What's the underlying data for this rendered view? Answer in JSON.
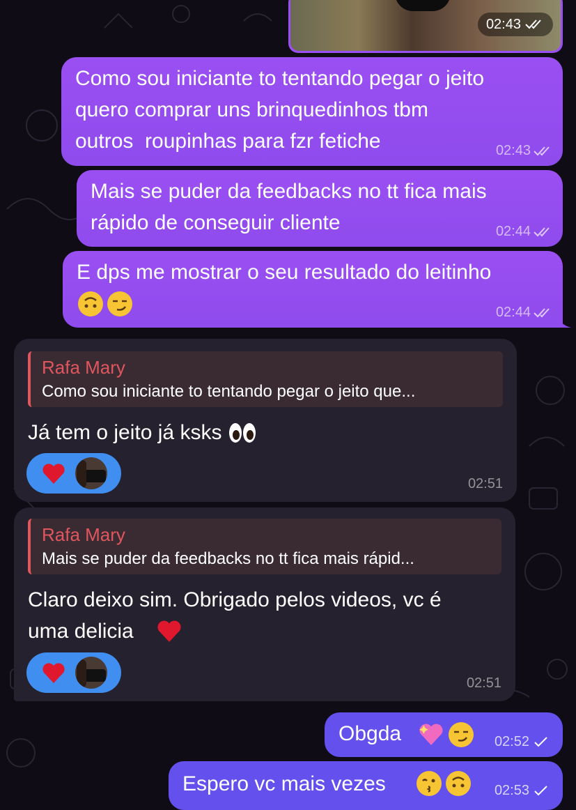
{
  "photo": {
    "time": "02:43"
  },
  "messages": [
    {
      "text": "Como sou iniciante to tentando pegar o jeito\nquero comprar uns brinquedinhos tbm\noutros  roupinhas para fzr fetiche",
      "time": "02:43"
    },
    {
      "text": "Mais se puder da feedbacks no tt fica mais\nrápido de conseguir cliente",
      "time": "02:44"
    },
    {
      "text": "E dps me mostrar o seu resultado do leitinho",
      "emojis": [
        "upside-down-face",
        "smirking-face"
      ],
      "time": "02:44"
    }
  ],
  "incoming": [
    {
      "reply_name": "Rafa Mary",
      "reply_text": "Como sou iniciante to tentando pegar o jeito que...",
      "text": "Já tem o jeito já ksks",
      "emoji": "eyes",
      "reaction": "red-heart",
      "time": "02:51"
    },
    {
      "reply_name": "Rafa Mary",
      "reply_text": "Mais se puder da feedbacks no tt fica mais rápid...",
      "text": "Claro deixo sim. Obrigado pelos videos, vc é\numa delicia",
      "emoji": "red-heart",
      "reaction": "red-heart",
      "time": "02:51"
    }
  ],
  "outgoing_last": [
    {
      "text": "Obgda",
      "emojis": [
        "sparkling-heart",
        "smirking-face"
      ],
      "time": "02:52"
    },
    {
      "text": "Espero vc mais vezes",
      "emojis": [
        "kissing-face",
        "upside-down-face"
      ],
      "time": "02:53"
    }
  ],
  "colors": {
    "background": "#100c16",
    "outgoing_purple": "#9a4ff2",
    "outgoing_blue": "#6450ec",
    "incoming": "#26212e",
    "reply_accent": "#e0565f",
    "reaction": "#3f8ef0"
  }
}
